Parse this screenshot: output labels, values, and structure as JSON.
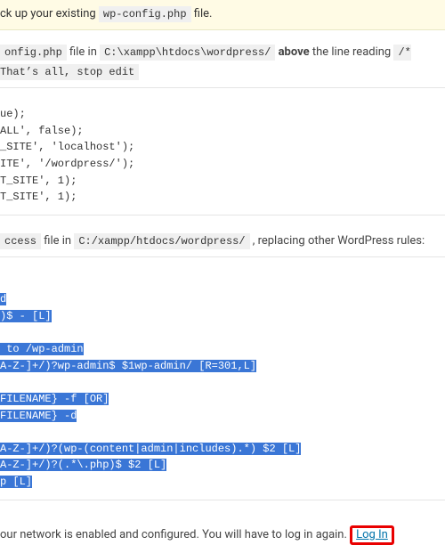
{
  "warning": {
    "prefix": "ck up your existing ",
    "file": "wp-config.php",
    "suffix": " file."
  },
  "instr1": {
    "prefix_file": "onfig.php",
    "mid1": " file in ",
    "path": "C:\\xampp\\htdocs\\wordpress/",
    "mid2": " ",
    "bold": "above",
    "mid3": " the line reading ",
    "code2": "/* That’s all, stop edit"
  },
  "code1": "ue);\nALL', false);\n_SITE', 'localhost');\nITE', '/wordpress/');\nT_SITE', 1);\nT_SITE', 1);",
  "instr2": {
    "file": "ccess",
    "mid1": " file in ",
    "path": "C:/xampp/htdocs/wordpress/",
    "suffix": ", replacing other WordPress rules:"
  },
  "code2_lines": [
    "",
    "d",
    ")$ - [L]",
    "",
    " to /wp-admin",
    "A-Z-]+/)?wp-admin$ $1wp-admin/ [R=301,L]",
    "",
    "FILENAME} -f [OR]",
    "FILENAME} -d",
    "",
    "A-Z-]+/)?(wp-(content|admin|includes).*) $2 [L]",
    "A-Z-]+/)?(.*\\.php)$ $2 [L]",
    "p [L]"
  ],
  "footer": {
    "text": "our network is enabled and configured. You will have to log in again. ",
    "link": "Log In"
  }
}
